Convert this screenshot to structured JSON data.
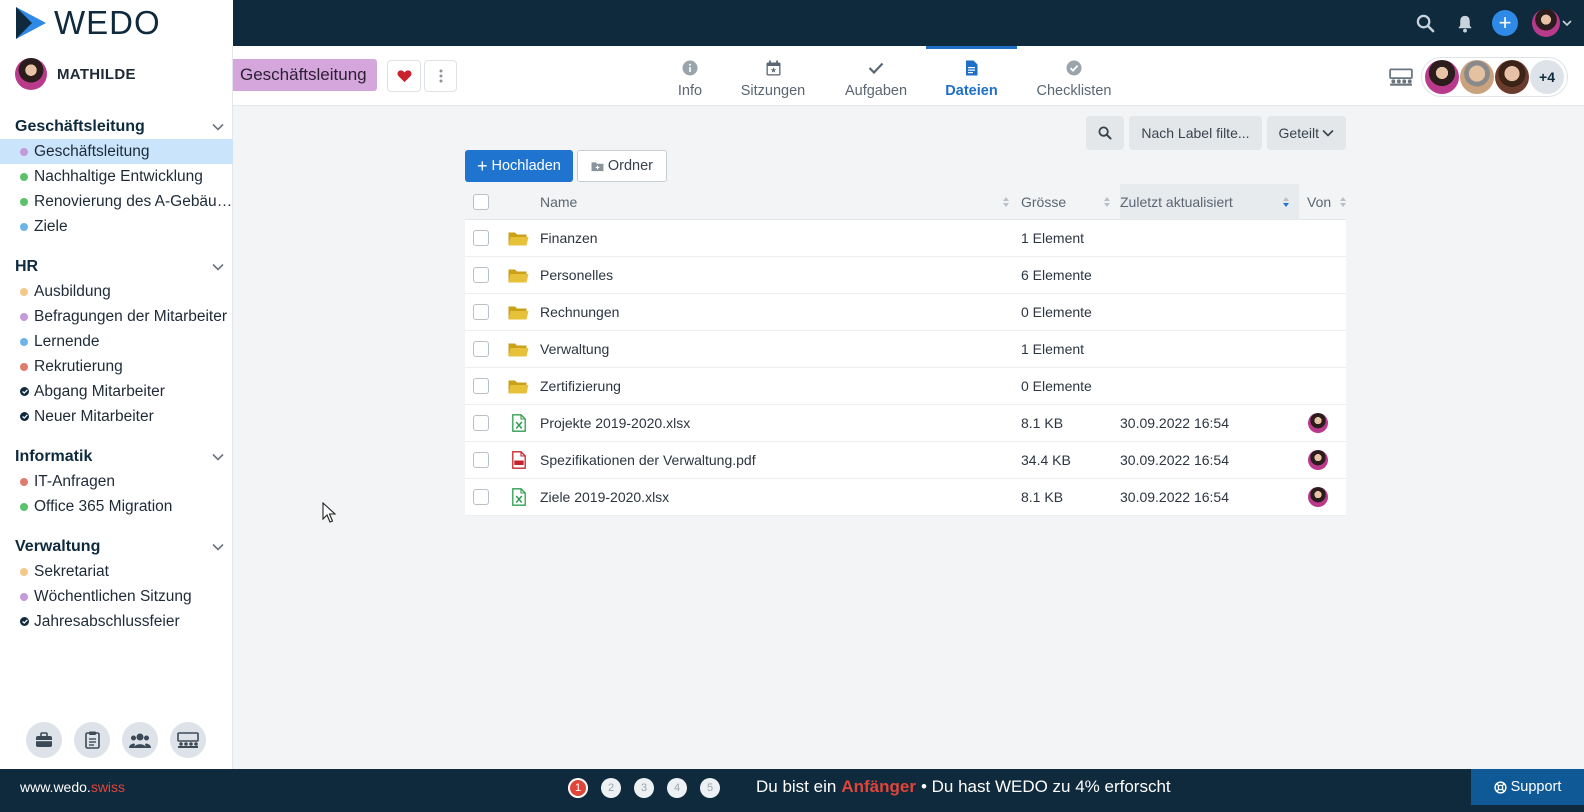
{
  "app": {
    "logo_text": "WEDO"
  },
  "user": {
    "name": "MATHILDE"
  },
  "sidebar": {
    "groups": [
      {
        "title": "Geschäftsleitung",
        "items": [
          {
            "label": "Geschäftsleitung",
            "color": "#c49ad8",
            "active": true
          },
          {
            "label": "Nachhaltige Entwicklung",
            "color": "#5bc26c"
          },
          {
            "label": "Renovierung des A-Gebäudes",
            "color": "#5bc26c"
          },
          {
            "label": "Ziele",
            "color": "#6db5e8"
          }
        ]
      },
      {
        "title": "HR",
        "items": [
          {
            "label": "Ausbildung",
            "color": "#f3c98a"
          },
          {
            "label": "Befragungen der Mitarbeiter",
            "color": "#c49ad8"
          },
          {
            "label": "Lernende",
            "color": "#6db5e8"
          },
          {
            "label": "Rekrutierung",
            "color": "#e07b70"
          },
          {
            "label": "Abgang Mitarbeiter",
            "type": "check"
          },
          {
            "label": "Neuer Mitarbeiter",
            "type": "check"
          }
        ]
      },
      {
        "title": "Informatik",
        "items": [
          {
            "label": "IT-Anfragen",
            "color": "#e07b70"
          },
          {
            "label": "Office 365 Migration",
            "color": "#5bc26c"
          }
        ]
      },
      {
        "title": "Verwaltung",
        "items": [
          {
            "label": "Sekretariat",
            "color": "#f3c98a"
          },
          {
            "label": "Wöchentlichen Sitzung",
            "color": "#c49ad8"
          },
          {
            "label": "Jahresabschlussfeier",
            "type": "check"
          }
        ]
      }
    ]
  },
  "workspace": {
    "title": "Geschäftsleitung",
    "title_color": "#d4a6dc"
  },
  "tabs": [
    {
      "label": "Info",
      "icon": "info-icon"
    },
    {
      "label": "Sitzungen",
      "icon": "calendar-icon"
    },
    {
      "label": "Aufgaben",
      "icon": "check-icon"
    },
    {
      "label": "Dateien",
      "icon": "file-icon",
      "active": true
    },
    {
      "label": "Checklisten",
      "icon": "checklist-icon"
    }
  ],
  "members": {
    "more_label": "+4"
  },
  "toolbar": {
    "filter_label": "Nach Label filte...",
    "shared_label": "Geteilt",
    "upload_label": "Hochladen",
    "folder_label": "Ordner"
  },
  "table": {
    "headers": {
      "name": "Name",
      "size": "Grösse",
      "updated": "Zuletzt aktualisiert",
      "by": "Von"
    },
    "rows": [
      {
        "type": "folder",
        "name": "Finanzen",
        "size": "1 Element",
        "updated": "",
        "by": false
      },
      {
        "type": "folder",
        "name": "Personelles",
        "size": "6 Elemente",
        "updated": "",
        "by": false
      },
      {
        "type": "folder",
        "name": "Rechnungen",
        "size": "0 Elemente",
        "updated": "",
        "by": false
      },
      {
        "type": "folder",
        "name": "Verwaltung",
        "size": "1 Element",
        "updated": "",
        "by": false
      },
      {
        "type": "folder",
        "name": "Zertifizierung",
        "size": "0 Elemente",
        "updated": "",
        "by": false
      },
      {
        "type": "xlsx",
        "name": "Projekte 2019-2020.xlsx",
        "size": "8.1 KB",
        "updated": "30.09.2022 16:54",
        "by": true
      },
      {
        "type": "pdf",
        "name": "Spezifikationen der Verwaltung.pdf",
        "size": "34.4 KB",
        "updated": "30.09.2022 16:54",
        "by": true
      },
      {
        "type": "xlsx",
        "name": "Ziele 2019-2020.xlsx",
        "size": "8.1 KB",
        "updated": "30.09.2022 16:54",
        "by": true
      }
    ]
  },
  "footer": {
    "site_main": "www.wedo.",
    "site_accent": "swiss",
    "steps": [
      "1",
      "2",
      "3",
      "4",
      "5"
    ],
    "current_step": "1",
    "text_before": "Du bist ein",
    "level": "Anfänger",
    "text_after": "• Du hast WEDO zu 4% erforscht",
    "support_label": "Support"
  },
  "colors": {
    "brand_dark": "#0e2a3c",
    "accent_blue": "#1f74cf",
    "accent_red": "#e0453a"
  }
}
